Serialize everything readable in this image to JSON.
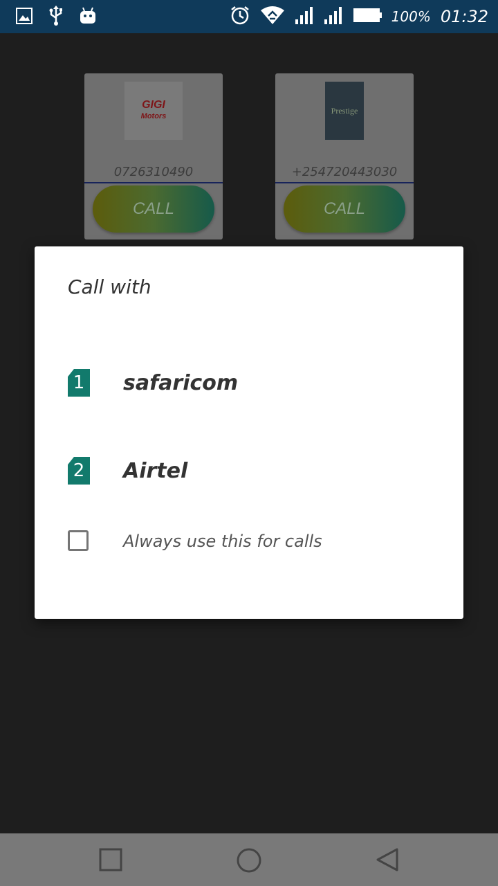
{
  "status_bar": {
    "battery_percent": "100%",
    "time": "01:32",
    "icons": [
      "image-icon",
      "usb-icon",
      "android-icon",
      "alarm-icon",
      "wifi-icon",
      "signal-icon",
      "signal-icon",
      "battery-icon"
    ]
  },
  "cards": [
    {
      "phone": "0726310490",
      "call_label": "CALL",
      "logo_line1": "GIGI",
      "logo_line2": "Motors"
    },
    {
      "phone": "+254720443030",
      "call_label": "CALL",
      "logo_line1": "Prestige",
      "logo_line2": ""
    }
  ],
  "dialog": {
    "title": "Call with",
    "options": [
      {
        "sim": "1",
        "label": "safaricom"
      },
      {
        "sim": "2",
        "label": "Airtel"
      }
    ],
    "checkbox_label": "Always use this for calls",
    "checkbox_checked": false
  },
  "nav_bar": {
    "icons": [
      "recents-icon",
      "home-icon",
      "back-icon"
    ]
  }
}
